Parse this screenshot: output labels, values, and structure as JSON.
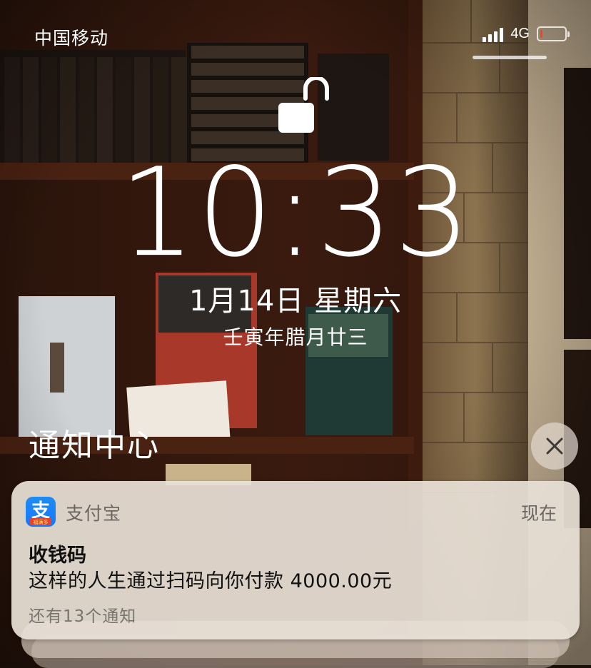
{
  "status_bar": {
    "carrier": "中国移动",
    "network": "4G",
    "signal_bars_active": 4,
    "battery_level": 0.1,
    "battery_color": "#ff3b30"
  },
  "lock_screen": {
    "lock_icon": "unlocked-padlock-icon",
    "time": "10:33",
    "date": "1月14日 星期六",
    "lunar_date": "壬寅年腊月廿三"
  },
  "notification_center": {
    "title": "通知中心",
    "clear_icon": "close-icon",
    "notification": {
      "app_icon": "alipay-icon",
      "app_icon_glyph": "支",
      "app_icon_badge": "福满多",
      "app_name": "支付宝",
      "timestamp": "现在",
      "title": "收钱码",
      "body": "这样的人生通过扫码向你付款 4000.00元",
      "more": "还有13个通知"
    }
  },
  "colors": {
    "alipay_blue": "#1677ff",
    "card_background": "#e8e0d6"
  }
}
